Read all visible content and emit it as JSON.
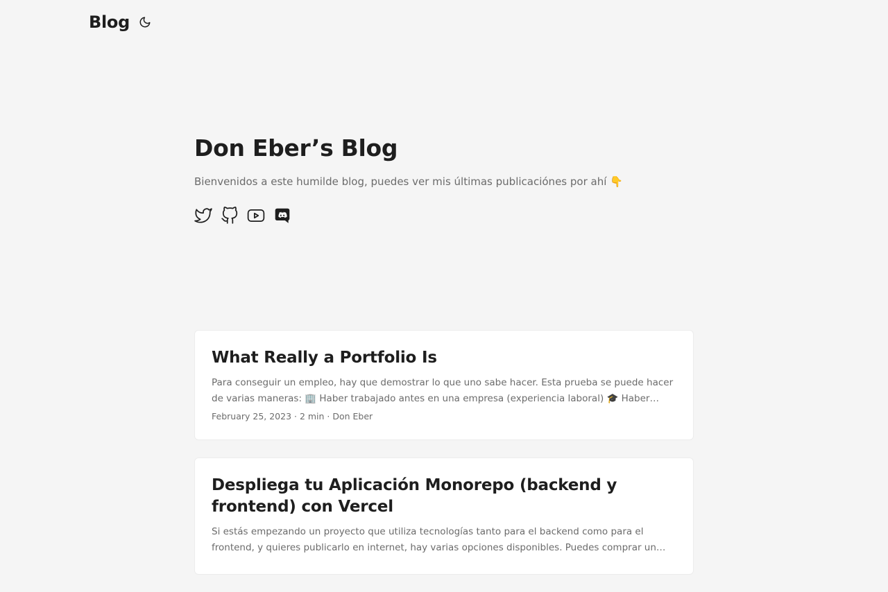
{
  "header": {
    "logo": "Blog",
    "theme_icon": "moon-icon"
  },
  "intro": {
    "title": "Don Eber’s Blog",
    "subtitle": "Bienvenidos a este humilde blog, puedes ver mis últimas publicaciónes por ahí 👇",
    "socials": [
      {
        "icon": "twitter-icon"
      },
      {
        "icon": "github-icon"
      },
      {
        "icon": "youtube-icon"
      },
      {
        "icon": "discord-icon"
      }
    ]
  },
  "posts": [
    {
      "title": "What Really a Portfolio Is",
      "excerpt": "Para conseguir un empleo, hay que demostrar lo que uno sabe hacer. Esta prueba se puede hacer de varias maneras: 🏢 Haber trabajado antes en una empresa (experiencia laboral) 🎓 Haber estudiado o tener…",
      "meta": "February 25, 2023 · 2 min · Don Eber"
    },
    {
      "title": "Despliega tu Aplicación Monorepo (backend y frontend) con Vercel",
      "excerpt": "Si estás empezando un proyecto que utiliza tecnologías tanto para el backend como para el frontend, y quieres publicarlo en internet, hay varias opciones disponibles. Puedes comprar un servidor y configurarlo,…",
      "meta": ""
    }
  ]
}
